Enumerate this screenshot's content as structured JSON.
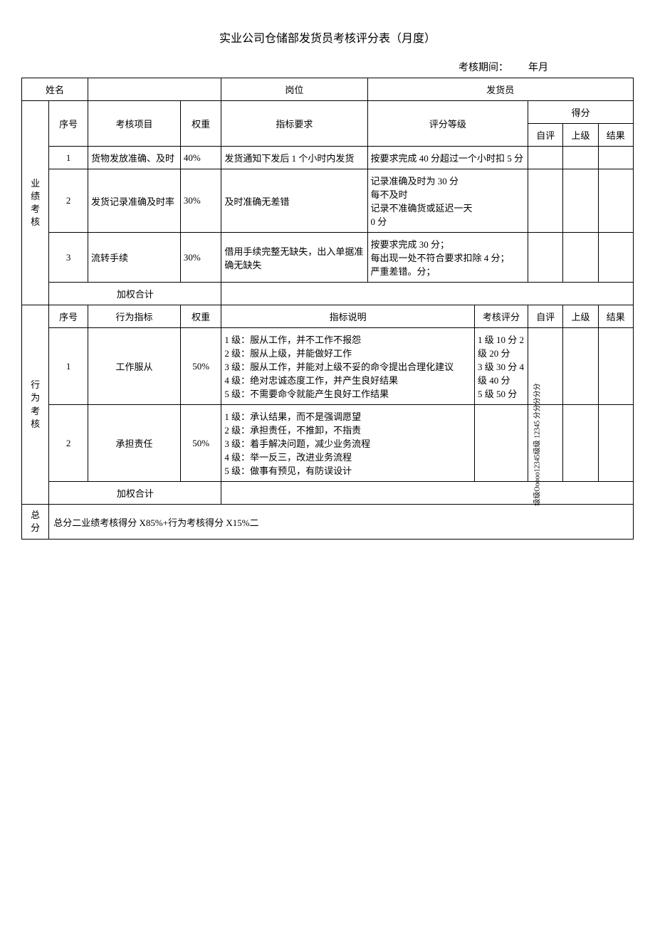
{
  "title": "实业公司仓储部发货员考核评分表（月度）",
  "period_label": "考核期间：",
  "period_value": "年月",
  "header": {
    "name_label": "姓名",
    "position_label": "岗位",
    "position_value": "发货员"
  },
  "perf": {
    "category": "业绩考核",
    "cols": {
      "seq": "序号",
      "item": "考核项目",
      "weight": "权重",
      "requirement": "指标要求",
      "grade": "评分等级",
      "score": "得分",
      "self": "自评",
      "sup": "上级",
      "result": "结果"
    },
    "rows": [
      {
        "seq": "1",
        "item": "货物发放准确、及时",
        "weight": "40%",
        "requirement": "发货通知下发后 1 个小时内发货",
        "grade": "按要求完成 40 分超过一个小时扣 5 分"
      },
      {
        "seq": "2",
        "item": "发货记录准确及时率",
        "weight": "30%",
        "requirement": "及时准确无差错",
        "grade": "记录准确及时为 30 分\n每不及时\n记录不准确货或延迟一天\n0 分"
      },
      {
        "seq": "3",
        "item": "流转手续",
        "weight": "30%",
        "requirement": "借用手续完整无缺失，出入单据准确无缺失",
        "grade": "按要求完成 30 分；\n每出现一处不符合要求扣除 4 分；\n严重差错。分；"
      }
    ],
    "subtotal": "加权合计"
  },
  "behav": {
    "category": "行为考核",
    "cols": {
      "seq": "序号",
      "item": "行为指标",
      "weight": "权重",
      "desc": "指标说明",
      "score": "考核评分",
      "self": "自评",
      "sup": "上级",
      "result": "结果"
    },
    "rows": [
      {
        "seq": "1",
        "item": "工作服从",
        "weight": "50%",
        "desc": "1 级：服从工作，并不工作不报怨\n2 级：服从上级，并能做好工作\n3 级：服从工作，并能对上级不妥的命令提出合理化建议\n4 级：绝对忠诚态度工作，并产生良好结果\n5 级：不需要命令就能产生良好工作结果",
        "score": "1 级 10 分 2 级 20 分\n3 级 30 分 4 级 40 分\n5 级 50 分"
      },
      {
        "seq": "2",
        "item": "承担责任",
        "weight": "50%",
        "desc": "1 级：承认结果，而不是强调愿望\n2 级：承担责任，不推卸，不指责\n3 级：着手解决问题，减少业务流程\n4 级：举一反三，改进业务流程\n5 级：做事有预见，有防误设计",
        "score_rot": "级级Ooooo12345级级 12345 分分分分分"
      }
    ],
    "subtotal": "加权合计"
  },
  "total": {
    "label": "总分",
    "formula": "总分二业绩考核得分 X85%+行为考核得分 X15%二"
  }
}
